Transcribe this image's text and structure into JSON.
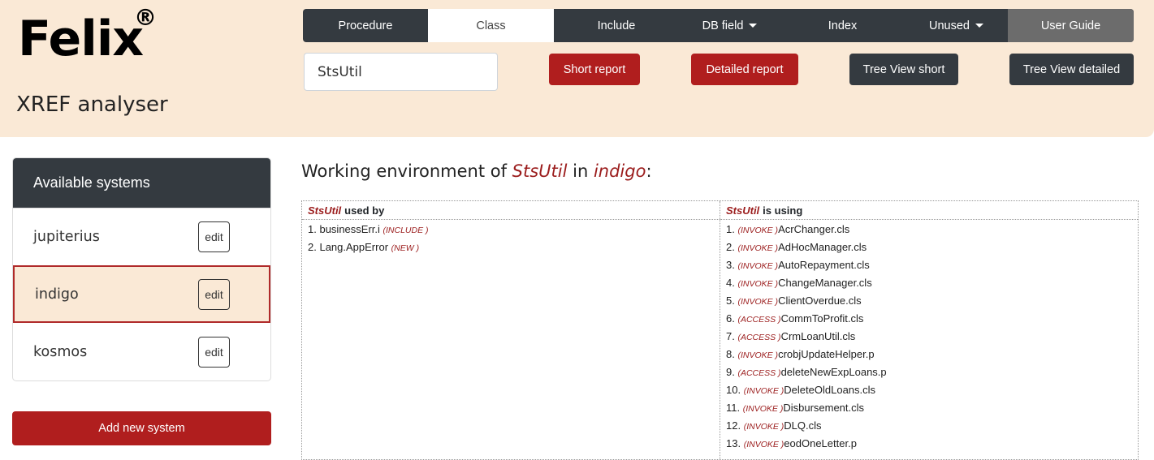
{
  "logo": {
    "name": "Felix",
    "mark": "®",
    "subtitle": "XREF analyser"
  },
  "nav": {
    "items": [
      {
        "label": "Procedure",
        "dropdown": false,
        "active": false
      },
      {
        "label": "Class",
        "dropdown": false,
        "active": true
      },
      {
        "label": "Include",
        "dropdown": false,
        "active": false
      },
      {
        "label": "DB field",
        "dropdown": true,
        "active": false
      },
      {
        "label": "Index",
        "dropdown": false,
        "active": false
      },
      {
        "label": "Unused",
        "dropdown": true,
        "active": false
      },
      {
        "label": "User Guide",
        "dropdown": false,
        "active": false
      }
    ]
  },
  "search": {
    "value": "StsUtil"
  },
  "actions": {
    "short_report": "Short report",
    "detailed_report": "Detailed report",
    "tree_short": "Tree View short",
    "tree_detailed": "Tree View detailed"
  },
  "sidebar": {
    "title": "Available systems",
    "systems": [
      {
        "name": "jupiterius",
        "edit": "edit",
        "selected": false
      },
      {
        "name": "indigo",
        "edit": "edit",
        "selected": true
      },
      {
        "name": "kosmos",
        "edit": "edit",
        "selected": false
      }
    ],
    "add_label": "Add new system"
  },
  "main": {
    "heading_prefix": "Working environment of ",
    "object": "StsUtil",
    "heading_mid": " in ",
    "system": "indigo",
    "heading_suffix": ":",
    "used_by_title": "used by",
    "using_title": "is using",
    "used_by": [
      {
        "n": "1.",
        "name": "businessErr.i",
        "tag": "(INCLUDE )"
      },
      {
        "n": "2.",
        "name": "Lang.AppError",
        "tag": "(NEW )"
      }
    ],
    "using": [
      {
        "n": "1.",
        "tag": "(INVOKE )",
        "name": "AcrChanger.cls"
      },
      {
        "n": "2.",
        "tag": "(INVOKE )",
        "name": "AdHocManager.cls"
      },
      {
        "n": "3.",
        "tag": "(INVOKE )",
        "name": "AutoRepayment.cls"
      },
      {
        "n": "4.",
        "tag": "(INVOKE )",
        "name": "ChangeManager.cls"
      },
      {
        "n": "5.",
        "tag": "(INVOKE )",
        "name": "ClientOverdue.cls"
      },
      {
        "n": "6.",
        "tag": "(ACCESS )",
        "name": "CommToProfit.cls"
      },
      {
        "n": "7.",
        "tag": "(ACCESS )",
        "name": "CrmLoanUtil.cls"
      },
      {
        "n": "8.",
        "tag": "(INVOKE )",
        "name": "crobjUpdateHelper.p"
      },
      {
        "n": "9.",
        "tag": "(ACCESS )",
        "name": "deleteNewExpLoans.p"
      },
      {
        "n": "10.",
        "tag": "(INVOKE )",
        "name": "DeleteOldLoans.cls"
      },
      {
        "n": "11.",
        "tag": "(INVOKE )",
        "name": "Disbursement.cls"
      },
      {
        "n": "12.",
        "tag": "(INVOKE )",
        "name": "DLQ.cls"
      },
      {
        "n": "13.",
        "tag": "(INVOKE )",
        "name": "eodOneLetter.p"
      }
    ]
  }
}
